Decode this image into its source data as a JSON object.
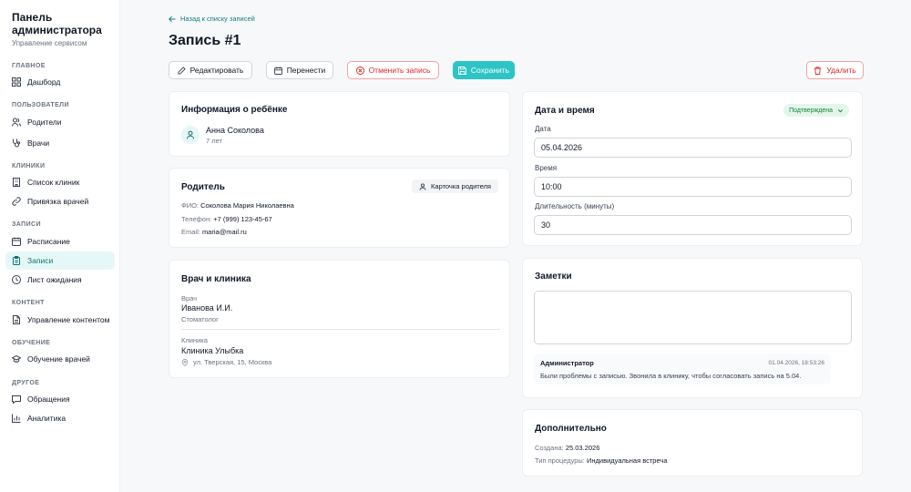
{
  "sidebar": {
    "title": "Панель администратора",
    "subtitle": "Управление сервисом",
    "sections": {
      "main": "ГЛАВНОЕ",
      "users": "ПОЛЬЗОВАТЕЛИ",
      "clinics": "КЛИНИКИ",
      "records": "ЗАПИСИ",
      "content": "КОНТЕНТ",
      "training": "ОБУЧЕНИЕ",
      "other": "ДРУГОЕ"
    },
    "items": {
      "dashboard": "Дашборд",
      "parents": "Родители",
      "doctors": "Врачи",
      "clinic_list": "Список клиник",
      "doctor_binding": "Привязка врачей",
      "schedule": "Расписание",
      "appointments": "Записи",
      "waitlist": "Лист ожидания",
      "content_management": "Управление контентом",
      "doctor_training": "Обучение врачей",
      "requests": "Обращения",
      "analytics": "Аналитика"
    },
    "active_item": "appointments",
    "accent_color": "#0f766e"
  },
  "header": {
    "back_label": "Назад к списку записей",
    "title": "Запись #1"
  },
  "toolbar": {
    "edit_label": "Редактировать",
    "move_label": "Перенести",
    "cancel_label": "Отменить запись",
    "save_label": "Сохранить",
    "delete_label": "Удалить"
  },
  "child": {
    "section_title": "Информация о ребёнке",
    "name": "Анна Соколова",
    "age": "7 лет"
  },
  "parent": {
    "section_title": "Родитель",
    "card_button": "Карточка родителя",
    "name_label": "ФИО:",
    "name_value": "Соколова Мария Николаевна",
    "phone_label": "Телефон:",
    "phone_value": "+7 (999) 123-45-67",
    "email_label": "Email:",
    "email_value": "maria@mail.ru"
  },
  "doctor_clinic": {
    "section_title": "Врач и клиника",
    "doctor_label": "Врач",
    "doctor_name": "Иванова И.И.",
    "doctor_specialty": "Стоматолог",
    "clinic_label": "Клиника",
    "clinic_name": "Клиника Улыбка",
    "clinic_address": "ул. Тверская, 15, Москва"
  },
  "datetime": {
    "section_title": "Дата и время",
    "status": "Подтверждена",
    "date_label": "Дата",
    "date_value": "05.04.2026",
    "time_label": "Время",
    "time_value": "10:00",
    "duration_label": "Длительность (минуты)",
    "duration_value": "30"
  },
  "notes": {
    "section_title": "Заметки",
    "note_author": "Администратор",
    "note_time": "01.04.2026, 18:53:26",
    "note_text": "Были проблемы с записью. Звонила в клинику, чтобы согласовать запись на 5.04."
  },
  "extra": {
    "section_title": "Дополнительно",
    "created_label": "Создана:",
    "created_value": "25.03.2026",
    "type_label": "Тип процедуры:",
    "type_value": "Индивидуальная встреча"
  },
  "colors": {
    "primary": "#2cc4c6",
    "danger": "#dc2626",
    "status_bg": "#e3f6ea",
    "status_text": "#15803d"
  }
}
